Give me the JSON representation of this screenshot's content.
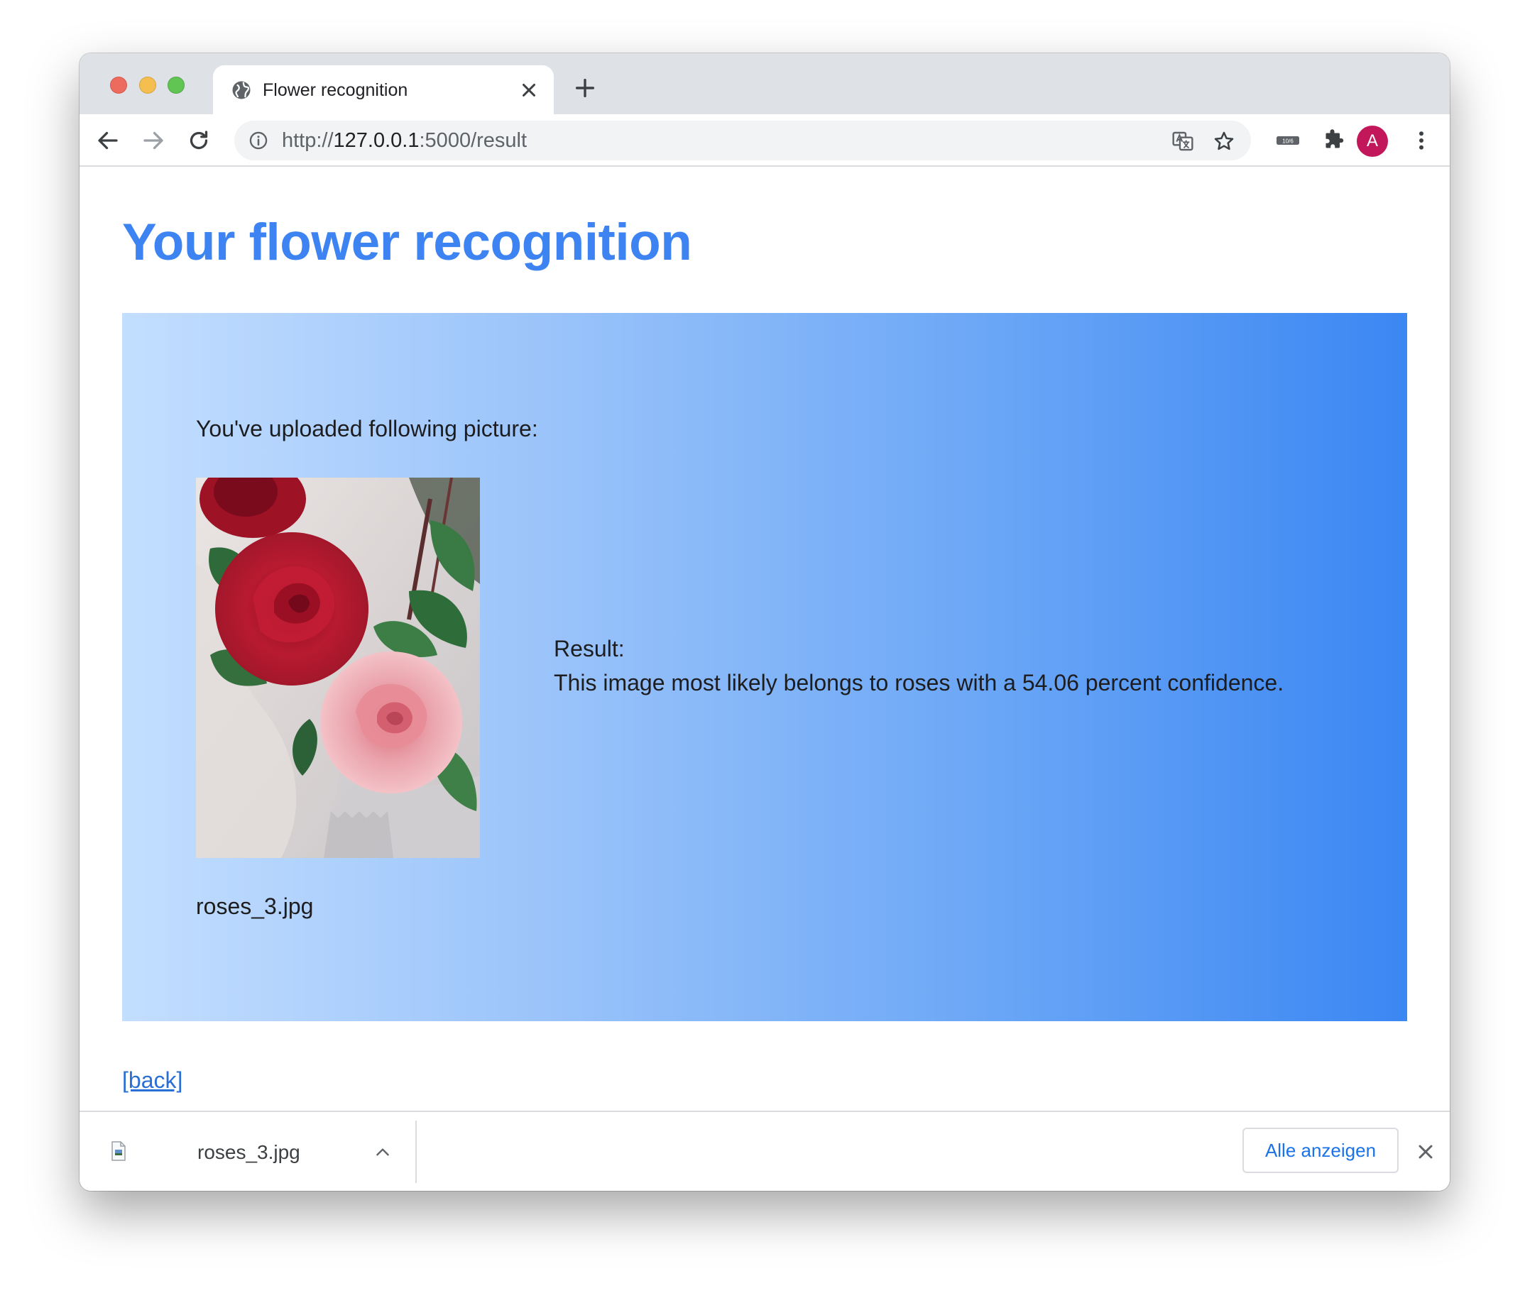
{
  "browser": {
    "tab_title": "Flower recognition",
    "url_scheme": "http://",
    "url_host": "127.0.0.1",
    "url_path": ":5000/result",
    "profile_initial": "A",
    "extension_badge": "10/6"
  },
  "page": {
    "title": "Your flower recognition",
    "uploaded_label": "You've uploaded following picture:",
    "filename": "roses_3.jpg",
    "result_label": "Result:",
    "result_text": "This image most likely belongs to roses with a 54.06 percent confidence.",
    "back_link": "[back]"
  },
  "download_bar": {
    "file_name": "roses_3.jpg",
    "show_all_label": "Alle anzeigen"
  },
  "colors": {
    "title_blue": "#3d84f2",
    "link_blue": "#2a6fd6",
    "gradient_start": "#c3deff",
    "gradient_end": "#3b87f3",
    "avatar": "#c2185b"
  }
}
